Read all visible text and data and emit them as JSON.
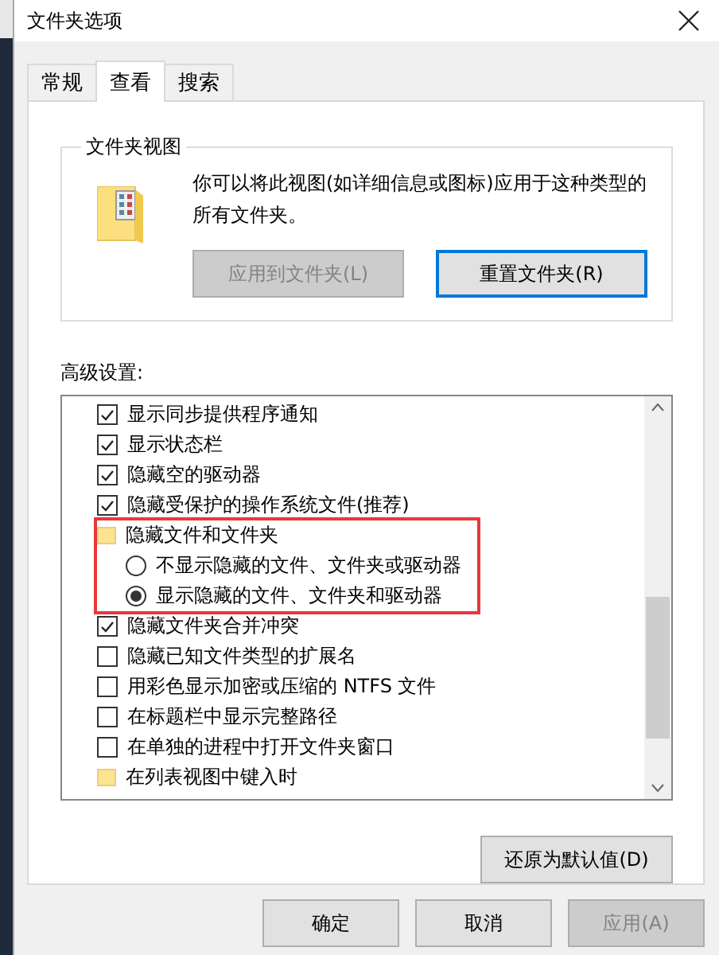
{
  "window": {
    "title": "文件夹选项"
  },
  "tabs": [
    {
      "label": "常规",
      "selected": false
    },
    {
      "label": "查看",
      "selected": true
    },
    {
      "label": "搜索",
      "selected": false
    }
  ],
  "folder_views": {
    "title": "文件夹视图",
    "description": "你可以将此视图(如详细信息或图标)应用于这种类型的所有文件夹。",
    "buttons": [
      {
        "label": "应用到文件夹(L)",
        "disabled": true,
        "focused": false
      },
      {
        "label": "重置文件夹(R)",
        "disabled": false,
        "focused": true
      }
    ]
  },
  "advanced": {
    "label": "高级设置:",
    "items": [
      {
        "kind": "checkbox",
        "label": "显示同步提供程序通知",
        "checked": true
      },
      {
        "kind": "checkbox",
        "label": "显示状态栏",
        "checked": true
      },
      {
        "kind": "checkbox",
        "label": "隐藏空的驱动器",
        "checked": true
      },
      {
        "kind": "checkbox",
        "label": "隐藏受保护的操作系统文件(推荐)",
        "checked": true
      },
      {
        "kind": "folder",
        "label": "隐藏文件和文件夹",
        "highlighted": true,
        "children": [
          {
            "kind": "radio",
            "label": "不显示隐藏的文件、文件夹或驱动器",
            "selected": false
          },
          {
            "kind": "radio",
            "label": "显示隐藏的文件、文件夹和驱动器",
            "selected": true
          }
        ]
      },
      {
        "kind": "checkbox",
        "label": "隐藏文件夹合并冲突",
        "checked": true
      },
      {
        "kind": "checkbox",
        "label": "隐藏已知文件类型的扩展名",
        "checked": false
      },
      {
        "kind": "checkbox",
        "label": "用彩色显示加密或压缩的 NTFS 文件",
        "checked": false
      },
      {
        "kind": "checkbox",
        "label": "在标题栏中显示完整路径",
        "checked": false
      },
      {
        "kind": "checkbox",
        "label": "在单独的进程中打开文件夹窗口",
        "checked": false
      },
      {
        "kind": "folder",
        "label": "在列表视图中键入时",
        "highlighted": false
      }
    ],
    "restore_button": "还原为默认值(D)"
  },
  "buttons": [
    {
      "label": "确定",
      "disabled": false
    },
    {
      "label": "取消",
      "disabled": false
    },
    {
      "label": "应用(A)",
      "disabled": true
    }
  ]
}
